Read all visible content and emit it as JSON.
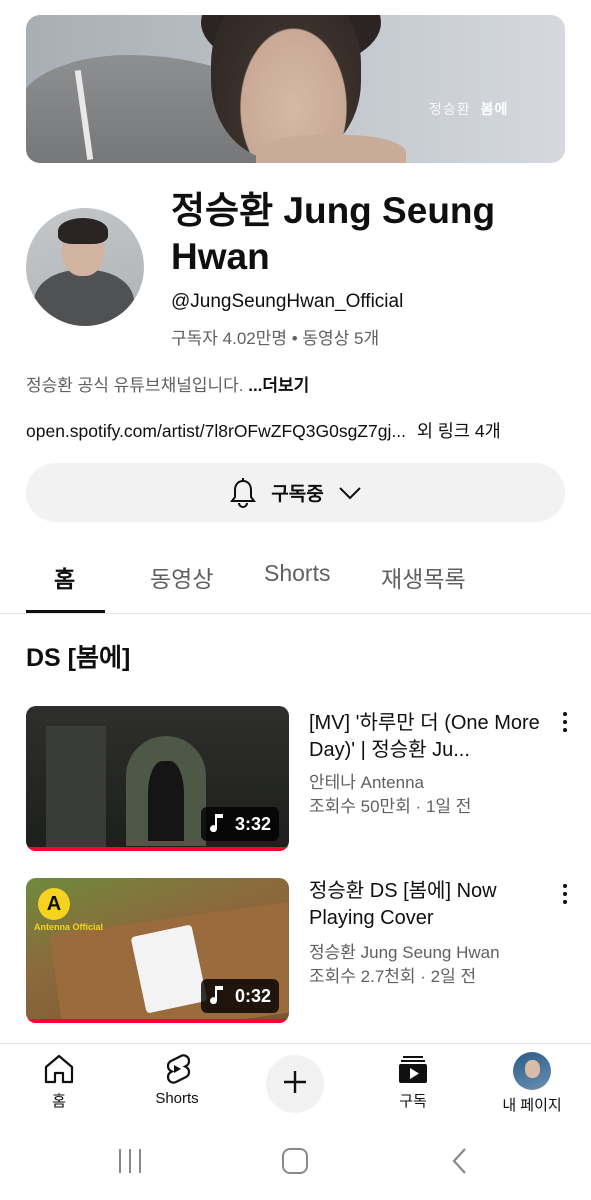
{
  "banner": {
    "artist_text": "정승환",
    "album_text": "봄에"
  },
  "channel": {
    "name": "정승환 Jung Seung Hwan",
    "handle": "@JungSeungHwan_Official",
    "stats": "구독자 4.02만명 • 동영상 5개",
    "description": "정승환 공식 유튜브채널입니다.",
    "description_more": "...더보기",
    "link": "open.spotify.com/artist/7l8rOFwZFQ3G0sgZ7gj...",
    "link_extra": "외 링크 4개"
  },
  "subscribe": {
    "label": "구독중"
  },
  "tabs": [
    {
      "label": "홈",
      "active": true
    },
    {
      "label": "동영상",
      "active": false
    },
    {
      "label": "Shorts",
      "active": false
    },
    {
      "label": "재생목록",
      "active": false
    }
  ],
  "section": {
    "title": "DS [봄에]"
  },
  "videos": [
    {
      "title": "[MV] '하루만 더 (One More Day)' | 정승환 Ju...",
      "channel": "안테나 Antenna",
      "meta": "조회수 50만회 · 1일 전",
      "duration": "3:32"
    },
    {
      "title": "정승환 DS [봄에] Now Playing Cover",
      "channel": "정승환 Jung Seung Hwan",
      "meta": "조회수 2.7천회 · 2일 전",
      "duration": "0:32",
      "thumb_badge": "A",
      "thumb_badge_text": "Antenna Official"
    }
  ],
  "bottom_nav": {
    "home": "홈",
    "shorts": "Shorts",
    "subscriptions": "구독",
    "you": "내 페이지"
  },
  "colors": {
    "accent_red": "#ff0033",
    "text_primary": "#0f0f0f",
    "text_secondary": "#606060"
  }
}
